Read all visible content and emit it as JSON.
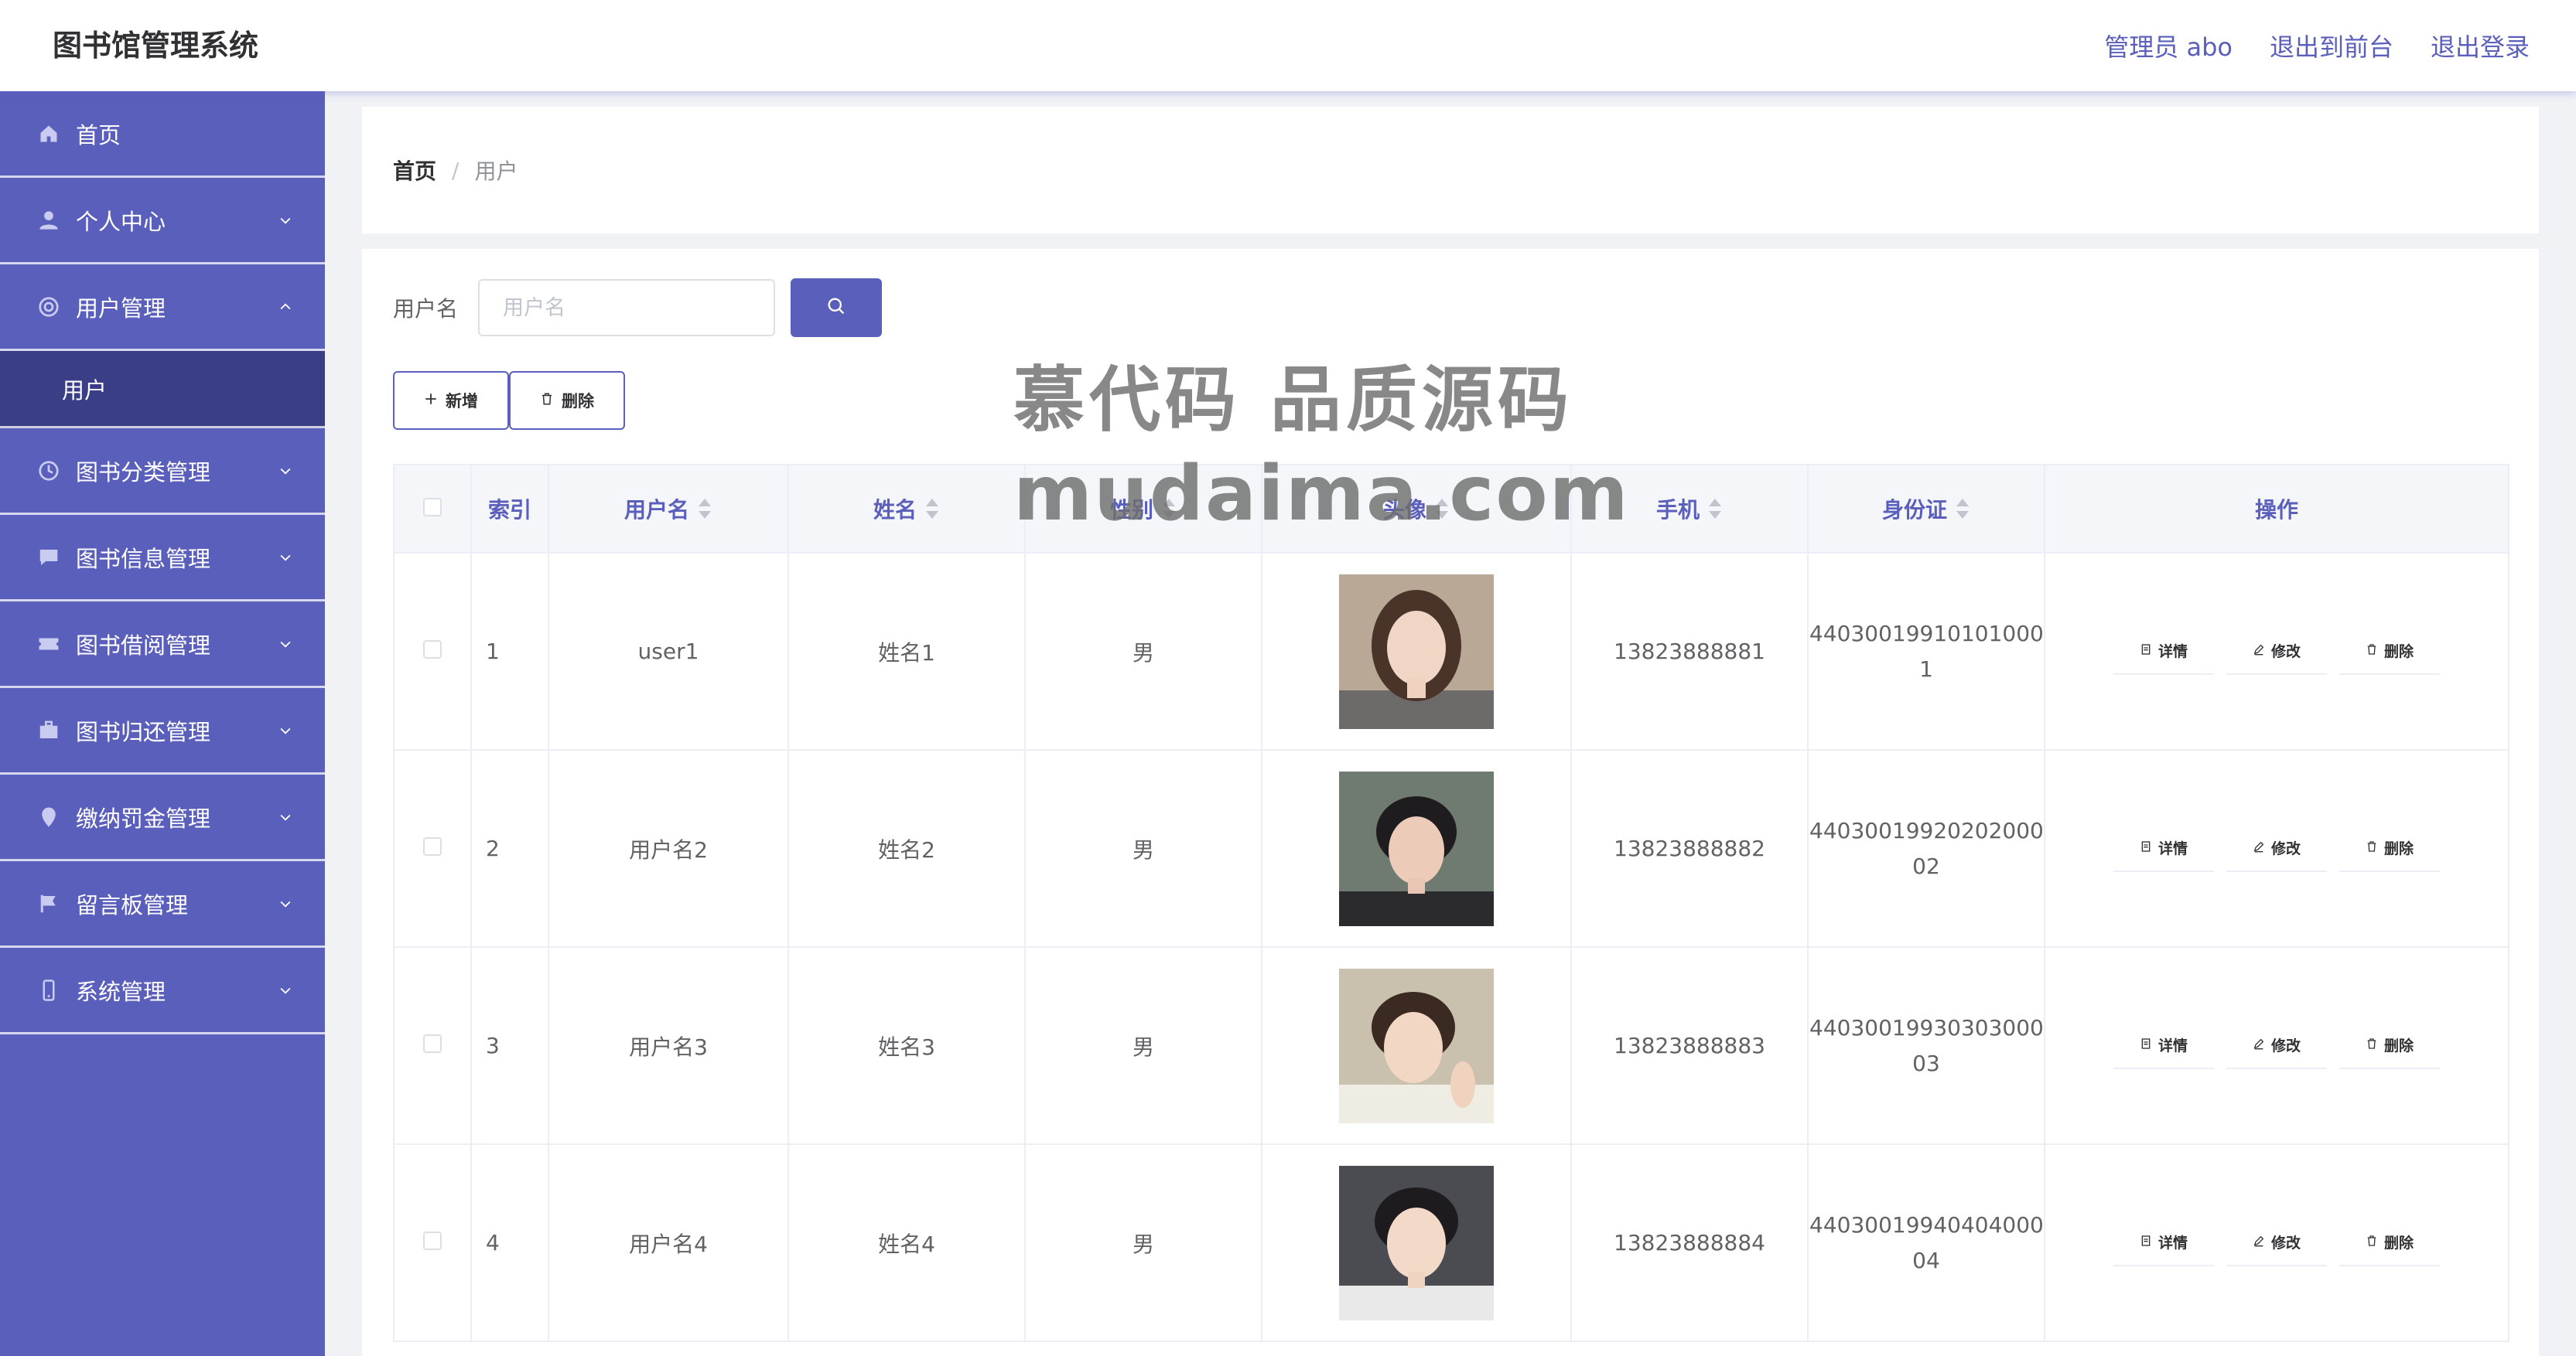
{
  "app": {
    "title": "图书馆管理系统"
  },
  "topnav": {
    "admin": "管理员 abo",
    "front": "退出到前台",
    "logout": "退出登录"
  },
  "sidebar": {
    "items": [
      {
        "label": "首页"
      },
      {
        "label": "个人中心"
      },
      {
        "label": "用户管理"
      },
      {
        "label": "用户"
      },
      {
        "label": "图书分类管理"
      },
      {
        "label": "图书信息管理"
      },
      {
        "label": "图书借阅管理"
      },
      {
        "label": "图书归还管理"
      },
      {
        "label": "缴纳罚金管理"
      },
      {
        "label": "留言板管理"
      },
      {
        "label": "系统管理"
      }
    ]
  },
  "breadcrumb": {
    "home": "首页",
    "sep": "/",
    "current": "用户"
  },
  "search": {
    "label": "用户名",
    "placeholder": "用户名"
  },
  "toolbar": {
    "add": "新增",
    "delete": "删除"
  },
  "table": {
    "headers": {
      "index": "索引",
      "username": "用户名",
      "name": "姓名",
      "gender": "性别",
      "avatar": "头像",
      "phone": "手机",
      "idcard": "身份证",
      "actions": "操作"
    },
    "action_labels": {
      "detail": "详情",
      "edit": "修改",
      "delete": "删除"
    },
    "rows": [
      {
        "index": "1",
        "username": "user1",
        "name": "姓名1",
        "gender": "男",
        "phone": "13823888881",
        "id1": "44030019910101000",
        "id2": "1"
      },
      {
        "index": "2",
        "username": "用户名2",
        "name": "姓名2",
        "gender": "男",
        "phone": "13823888882",
        "id1": "44030019920202000",
        "id2": "02"
      },
      {
        "index": "3",
        "username": "用户名3",
        "name": "姓名3",
        "gender": "男",
        "phone": "13823888883",
        "id1": "44030019930303000",
        "id2": "03"
      },
      {
        "index": "4",
        "username": "用户名4",
        "name": "姓名4",
        "gender": "男",
        "phone": "13823888884",
        "id1": "44030019940404000",
        "id2": "04"
      }
    ]
  },
  "watermark": {
    "line1": "慕代码 品质源码",
    "line2": "mudaima.com"
  },
  "colors": {
    "accent": "#5a5fbb",
    "sidebar_active": "#3a3e86"
  },
  "icons": [
    "home-icon",
    "user-icon",
    "lifebuoy-icon",
    "chevron-down-icon",
    "chevron-up-icon",
    "search-icon",
    "plus-icon",
    "trash-icon",
    "detail-icon",
    "edit-icon",
    "sort-icon"
  ]
}
